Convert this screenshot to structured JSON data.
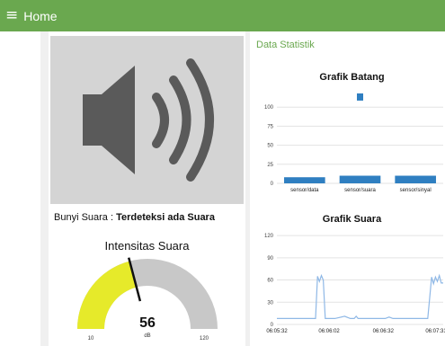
{
  "header": {
    "menu_icon": "≡",
    "title": "Home"
  },
  "left": {
    "speaker_icon": "speaker-volume-icon",
    "sound_label": "Bunyi Suara :",
    "sound_status": "Terdeteksi ada Suara"
  },
  "gauge": {
    "title": "Intensitas Suara",
    "value": 56,
    "min": 10,
    "max": 120,
    "unit": "dB",
    "fill_color": "#e6ea2a",
    "track_color": "#c8c8c8"
  },
  "right": {
    "section_title": "Data Statistik"
  },
  "chart_data": [
    {
      "type": "bar",
      "title": "Grafik Batang",
      "categories": [
        "sensor/data",
        "sensor/suara",
        "sensor/sinyal"
      ],
      "values": [
        8,
        10,
        10
      ],
      "extra_points": [
        {
          "category": "sensor/suara",
          "value": 118
        }
      ],
      "yticks": [
        0,
        25,
        50,
        75,
        100
      ],
      "ylim": [
        0,
        125
      ],
      "color": "#2f7fc1",
      "grid": true
    },
    {
      "type": "line",
      "title": "Grafik Suara",
      "xticks": [
        "06:05:32",
        "06:06:02",
        "06:06:32",
        "06:07:31"
      ],
      "yticks": [
        0,
        30,
        60,
        90,
        120
      ],
      "ylim": [
        0,
        125
      ],
      "color": "#8fb8e6",
      "grid": true,
      "series": [
        {
          "t": [
            0,
            20,
            21,
            22,
            23,
            24,
            25,
            26,
            30,
            35,
            38,
            40,
            41,
            42,
            44,
            48,
            56,
            58,
            60,
            62,
            66,
            72,
            78,
            79,
            80,
            81,
            82,
            83,
            84,
            85,
            86
          ],
          "y": [
            8,
            8,
            65,
            58,
            66,
            60,
            8,
            8,
            8,
            11,
            8,
            8,
            11,
            8,
            8,
            8,
            8,
            10,
            8,
            8,
            8,
            8,
            8,
            35,
            64,
            55,
            64,
            58,
            66,
            56,
            56
          ]
        }
      ]
    }
  ]
}
